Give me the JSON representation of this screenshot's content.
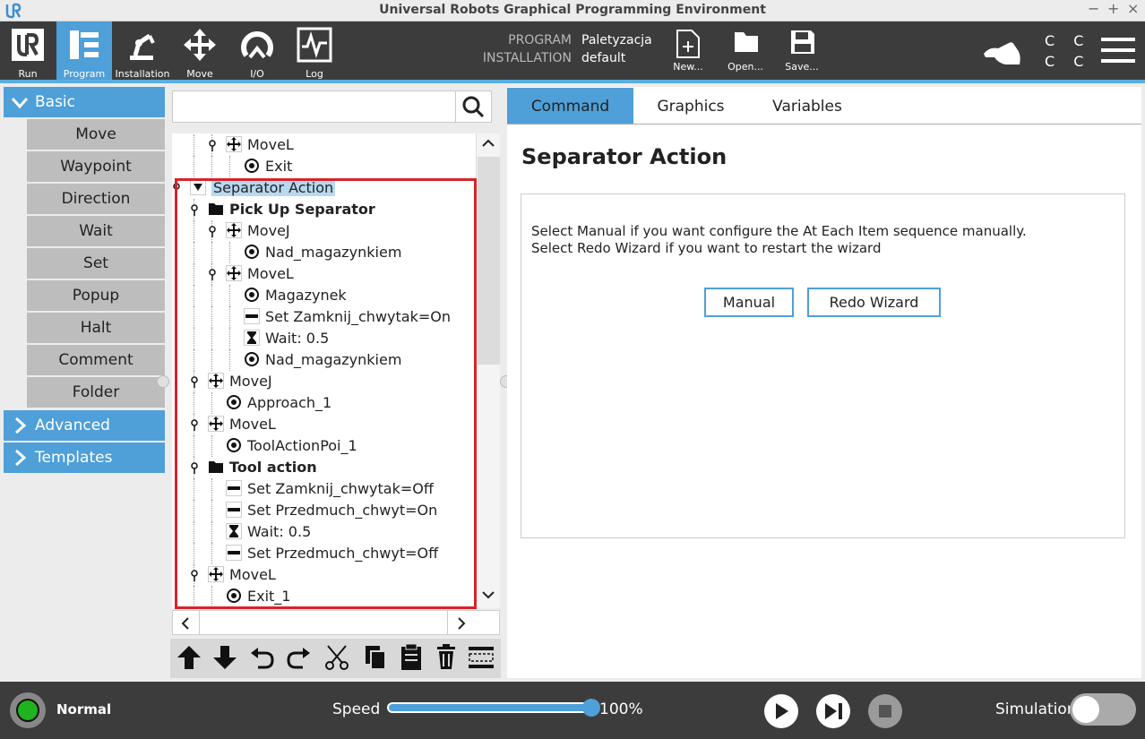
{
  "window": {
    "title": "Universal Robots Graphical Programming Environment"
  },
  "nav": [
    {
      "id": "run",
      "label": "Run"
    },
    {
      "id": "program",
      "label": "Program"
    },
    {
      "id": "installation",
      "label": "Installation"
    },
    {
      "id": "move",
      "label": "Move"
    },
    {
      "id": "io",
      "label": "I/O"
    },
    {
      "id": "log",
      "label": "Log"
    }
  ],
  "program_info": {
    "program_label": "PROGRAM",
    "program_value": "Paletyzacja",
    "installation_label": "INSTALLATION",
    "installation_value": "default"
  },
  "file_buttons": {
    "new": "New...",
    "open": "Open...",
    "save": "Save..."
  },
  "cc_label": "C C",
  "toolbox": {
    "basic": "Basic",
    "items": [
      "Move",
      "Waypoint",
      "Direction",
      "Wait",
      "Set",
      "Popup",
      "Halt",
      "Comment",
      "Folder"
    ],
    "advanced": "Advanced",
    "templates": "Templates"
  },
  "tree": [
    {
      "label": "MoveL",
      "icon": "move-icon",
      "bold": false
    },
    {
      "label": "Exit",
      "icon": "waypoint-icon",
      "bold": false
    },
    {
      "label": "Separator Action",
      "icon": "expand-triangle-icon",
      "bold": false,
      "selected": true
    },
    {
      "label": "Pick Up Separator",
      "icon": "folder-icon",
      "bold": true
    },
    {
      "label": "MoveJ",
      "icon": "move-icon",
      "bold": false
    },
    {
      "label": "Nad_magazynkiem",
      "icon": "waypoint-icon",
      "bold": false
    },
    {
      "label": "MoveL",
      "icon": "move-icon",
      "bold": false
    },
    {
      "label": "Magazynek",
      "icon": "waypoint-icon",
      "bold": false
    },
    {
      "label": "Set Zamknij_chwytak=On",
      "icon": "set-icon",
      "bold": false
    },
    {
      "label": "Wait: 0.5",
      "icon": "hourglass-icon",
      "bold": false
    },
    {
      "label": "Nad_magazynkiem",
      "icon": "waypoint-icon",
      "bold": false
    },
    {
      "label": "MoveJ",
      "icon": "move-icon",
      "bold": false
    },
    {
      "label": "Approach_1",
      "icon": "waypoint-icon",
      "bold": false
    },
    {
      "label": "MoveL",
      "icon": "move-icon",
      "bold": false
    },
    {
      "label": "ToolActionPoi_1",
      "icon": "waypoint-icon",
      "bold": false
    },
    {
      "label": "Tool action",
      "icon": "folder-icon",
      "bold": true
    },
    {
      "label": "Set Zamknij_chwytak=Off",
      "icon": "set-icon",
      "bold": false
    },
    {
      "label": "Set Przedmuch_chwyt=On",
      "icon": "set-icon",
      "bold": false
    },
    {
      "label": "Wait: 0.5",
      "icon": "hourglass-icon",
      "bold": false
    },
    {
      "label": "Set Przedmuch_chwyt=Off",
      "icon": "set-icon",
      "bold": false
    },
    {
      "label": "MoveL",
      "icon": "move-icon",
      "bold": false
    },
    {
      "label": "Exit_1",
      "icon": "waypoint-icon",
      "bold": false
    }
  ],
  "tabs": [
    "Command",
    "Graphics",
    "Variables"
  ],
  "command": {
    "title": "Separator Action",
    "line1": "Select Manual if you want configure the At Each Item sequence manually.",
    "line2": "Select Redo Wizard if you want to restart the wizard",
    "manual_btn": "Manual",
    "redo_btn": "Redo Wizard"
  },
  "footer": {
    "status": "Normal",
    "speed_label": "Speed",
    "speed_value": "100%",
    "speed_fraction": 1.0,
    "simulation_label": "Simulation"
  },
  "colors": {
    "accent": "#4f9fd8",
    "highlight": "#d8232a",
    "status_ok": "#1fb31f"
  }
}
